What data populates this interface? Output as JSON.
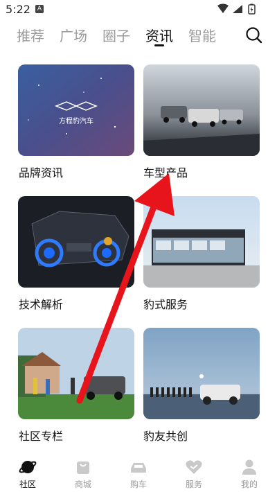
{
  "status_bar": {
    "time": "5:22",
    "badge": "A"
  },
  "tabs": [
    {
      "label": "推荐"
    },
    {
      "label": "广场"
    },
    {
      "label": "圈子"
    },
    {
      "label": "资讯"
    },
    {
      "label": "智能"
    }
  ],
  "active_tab": "资讯",
  "cards": [
    {
      "label": "品牌资讯",
      "overlay_text": "方程豹汽车"
    },
    {
      "label": "车型产品"
    },
    {
      "label": "技术解析"
    },
    {
      "label": "豹式服务"
    },
    {
      "label": "社区专栏"
    },
    {
      "label": "豹友共创"
    }
  ],
  "bottom_nav": [
    {
      "label": "社区"
    },
    {
      "label": "商城"
    },
    {
      "label": "购车"
    },
    {
      "label": "服务"
    },
    {
      "label": "我的"
    }
  ],
  "colors": {
    "accent": "#111111",
    "inactive": "#9a9a9a",
    "arrow": "#e8141b"
  }
}
